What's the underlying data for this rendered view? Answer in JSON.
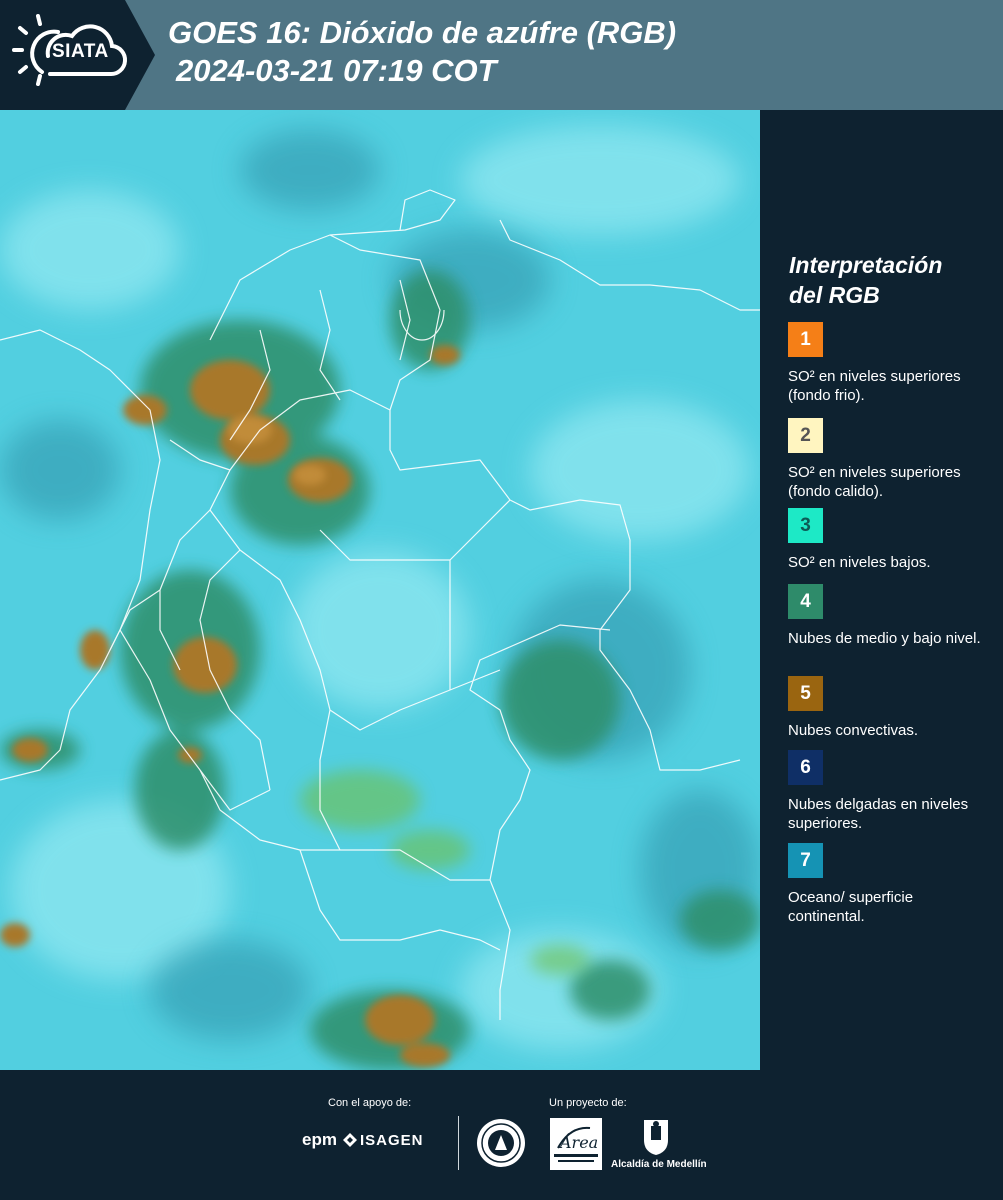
{
  "header": {
    "logo_text": "SIATA",
    "title_line1": "GOES 16: Dióxido de azúfre (RGB)",
    "title_line2": "2024-03-21 07:19 COT"
  },
  "legend": {
    "title_line1": "Interpretación",
    "title_line2": "del RGB",
    "items": [
      {
        "num": "1",
        "color": "#f57f17",
        "label": "SO² en niveles superiores (fondo frio)."
      },
      {
        "num": "2",
        "color": "#fff5c0",
        "label": "SO² en niveles superiores (fondo calido)."
      },
      {
        "num": "3",
        "color": "#1de9c6",
        "label": "SO² en niveles bajos."
      },
      {
        "num": "4",
        "color": "#2e8b6a",
        "label": "Nubes de medio y bajo nivel."
      },
      {
        "num": "5",
        "color": "#9a6510",
        "label": "Nubes convectivas."
      },
      {
        "num": "6",
        "color": "#0f2f66",
        "label": "Nubes delgadas en niveles superiores."
      },
      {
        "num": "7",
        "color": "#1593b4",
        "label": "Oceano/ superficie continental."
      }
    ]
  },
  "footer": {
    "support_label": "Con el apoyo de:",
    "project_label": "Un proyecto de:",
    "sponsor1": "epm",
    "sponsor2": "ISAGEN",
    "partner3": "Alcaldía de Medellín"
  }
}
